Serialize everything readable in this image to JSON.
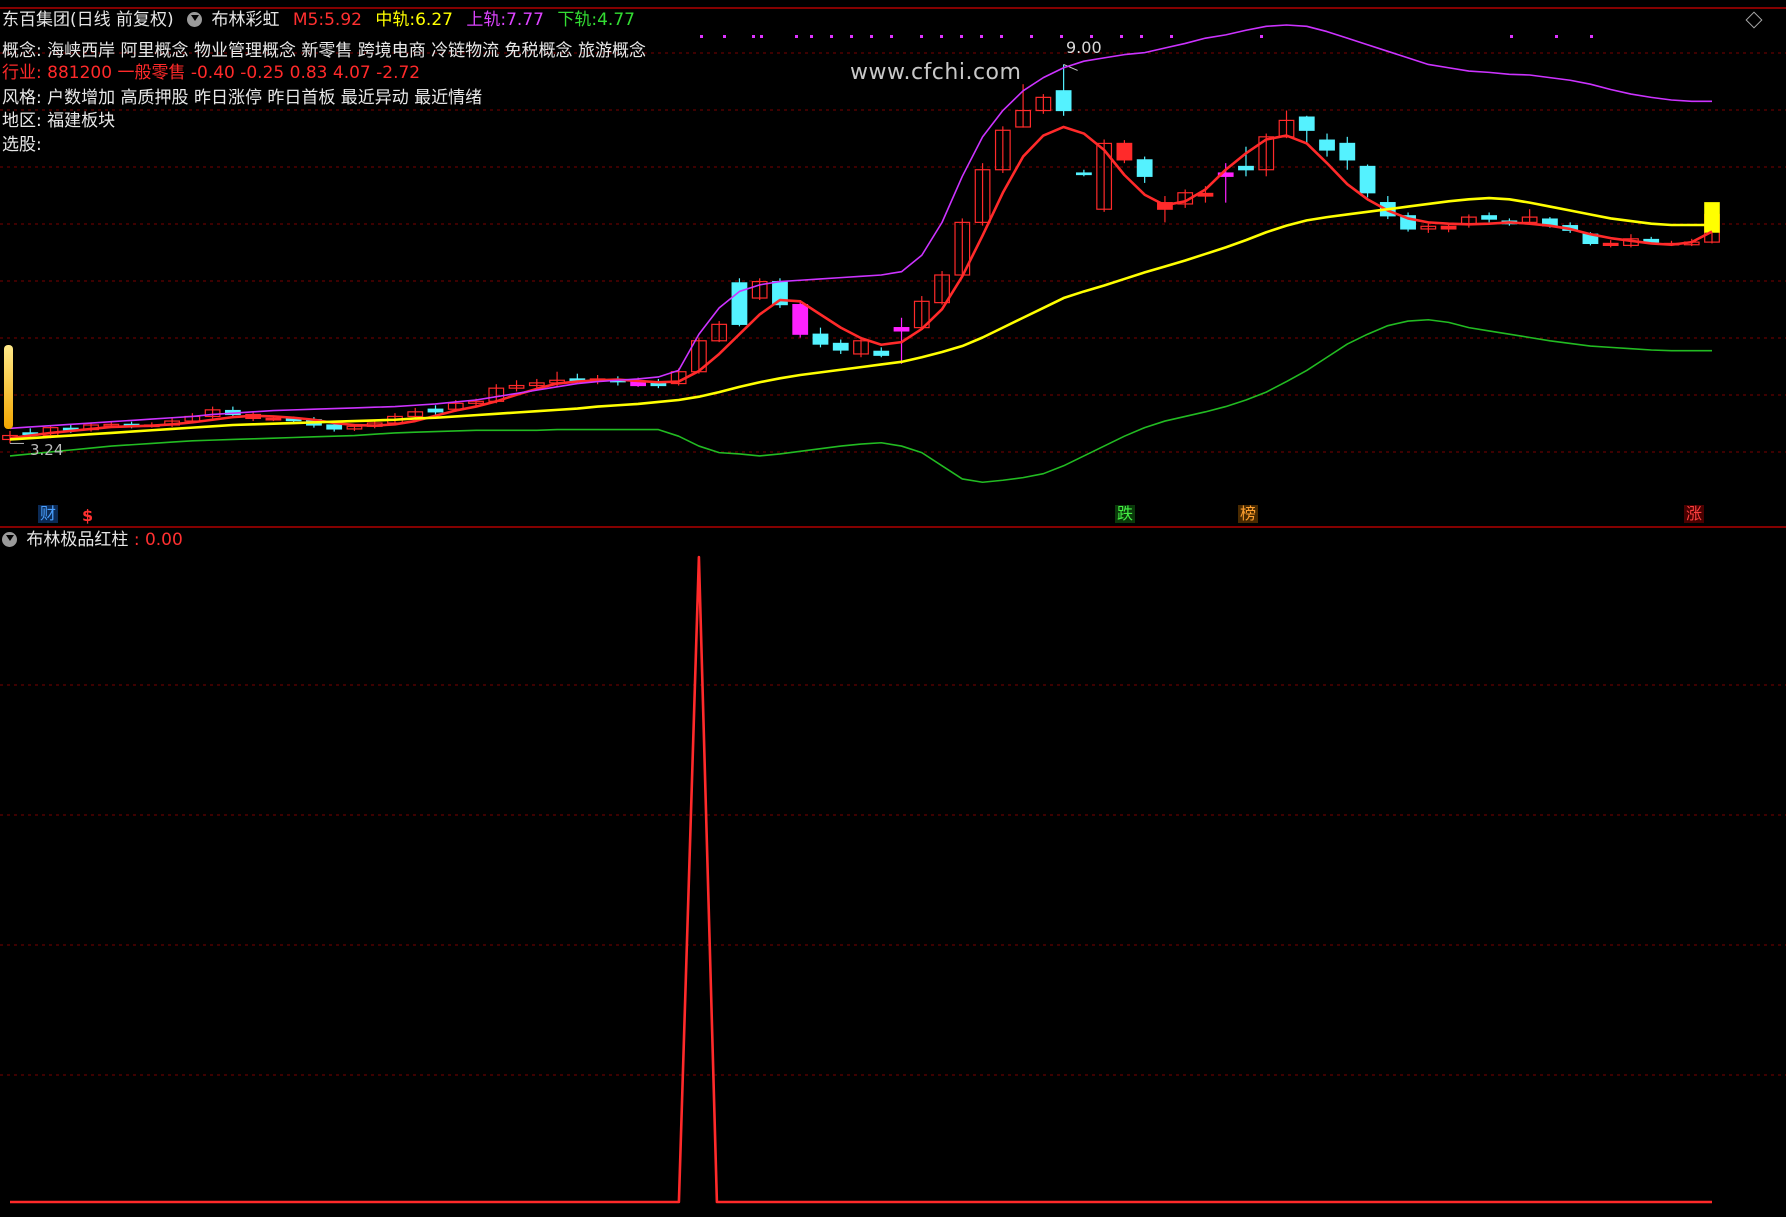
{
  "header": {
    "stock_title": "东百集团(日线 前复权)",
    "indicator_name": "布林彩虹",
    "m5_label": "M5:",
    "m5_value": "5.92",
    "mid_label": "中轨:",
    "mid_value": "6.27",
    "upper_label": "上轨:",
    "upper_value": "7.77",
    "lower_label": "下轨:",
    "lower_value": "4.77"
  },
  "info": {
    "concept_label": "概念:",
    "concept_value": "海峡西岸 阿里概念 物业管理概念 新零售 跨境电商 冷链物流 免税概念 旅游概念",
    "industry_label": "行业:",
    "industry_value": "881200 一般零售 -0.40 -0.25 0.83 4.07 -2.72",
    "style_label": "风格:",
    "style_value": "户数增加 高质押股 昨日涨停 昨日首板 最近异动 最近情绪",
    "region_label": "地区:",
    "region_value": "福建板块",
    "pick_label": "选股:"
  },
  "watermark": "www.cfchi.com",
  "price_labels": {
    "high": "9.00",
    "low": "3.24"
  },
  "badges": {
    "cai": "财",
    "dollar": "$",
    "die": "跌",
    "bang": "榜",
    "zhang": "涨"
  },
  "sub_panel": {
    "name": "布林极品红柱",
    "value_text": ": 0.00",
    "spike_index": 34
  },
  "colors": {
    "background": "#000000",
    "up": "#ff2a2a",
    "down": "#54f2ff",
    "highlight": "#ff22ff",
    "yellow": "#ffff00",
    "upper_band": "#cc33ff",
    "lower_band": "#22bb22",
    "grid": "#7a0000"
  },
  "chart_data": {
    "type": "candlestick",
    "x": [
      0,
      1,
      2,
      3,
      4,
      5,
      6,
      7,
      8,
      9,
      10,
      11,
      12,
      13,
      14,
      15,
      16,
      17,
      18,
      19,
      20,
      21,
      22,
      23,
      24,
      25,
      26,
      27,
      28,
      29,
      30,
      31,
      32,
      33,
      34,
      35,
      36,
      37,
      38,
      39,
      40,
      41,
      42,
      43,
      44,
      45,
      46,
      47,
      48,
      49,
      50,
      51,
      52,
      53,
      54,
      55,
      56,
      57,
      58,
      59,
      60,
      61,
      62,
      63,
      64,
      65,
      66,
      67,
      68,
      69,
      70,
      71,
      72,
      73,
      74,
      75,
      76,
      77,
      78,
      79,
      80,
      81,
      82,
      83,
      84
    ],
    "ylim": [
      2.0,
      9.6
    ],
    "candles": [
      [
        3.3,
        3.36,
        3.43,
        3.24,
        "up"
      ],
      [
        3.38,
        3.4,
        3.47,
        3.33,
        "down"
      ],
      [
        3.36,
        3.48,
        3.52,
        3.32,
        "up"
      ],
      [
        3.47,
        3.45,
        3.52,
        3.4,
        "down"
      ],
      [
        3.45,
        3.52,
        3.56,
        3.42,
        "up"
      ],
      [
        3.52,
        3.53,
        3.58,
        3.49,
        "up"
      ],
      [
        3.53,
        3.51,
        3.57,
        3.47,
        "down"
      ],
      [
        3.51,
        3.52,
        3.56,
        3.48,
        "up"
      ],
      [
        3.52,
        3.58,
        3.62,
        3.49,
        "up"
      ],
      [
        3.58,
        3.65,
        3.7,
        3.55,
        "up"
      ],
      [
        3.65,
        3.75,
        3.8,
        3.62,
        "up"
      ],
      [
        3.74,
        3.68,
        3.8,
        3.64,
        "down"
      ],
      [
        3.68,
        3.62,
        3.72,
        3.58,
        "up"
      ],
      [
        3.62,
        3.61,
        3.66,
        3.58,
        "up"
      ],
      [
        3.61,
        3.6,
        3.65,
        3.56,
        "down"
      ],
      [
        3.6,
        3.52,
        3.64,
        3.48,
        "down"
      ],
      [
        3.52,
        3.46,
        3.55,
        3.42,
        "down"
      ],
      [
        3.46,
        3.5,
        3.53,
        3.43,
        "up"
      ],
      [
        3.5,
        3.55,
        3.58,
        3.47,
        "up"
      ],
      [
        3.55,
        3.65,
        3.7,
        3.53,
        "up"
      ],
      [
        3.65,
        3.72,
        3.78,
        3.62,
        "up"
      ],
      [
        3.72,
        3.76,
        3.82,
        3.68,
        "down"
      ],
      [
        3.76,
        3.85,
        3.9,
        3.72,
        "up"
      ],
      [
        3.85,
        3.88,
        3.92,
        3.8,
        "up"
      ],
      [
        3.88,
        4.08,
        4.14,
        3.85,
        "up"
      ],
      [
        4.08,
        4.12,
        4.2,
        4.03,
        "up"
      ],
      [
        4.12,
        4.16,
        4.22,
        4.08,
        "up"
      ],
      [
        4.16,
        4.2,
        4.33,
        4.1,
        "up"
      ],
      [
        4.2,
        4.22,
        4.3,
        4.15,
        "down"
      ],
      [
        4.22,
        4.2,
        4.28,
        4.14,
        "up"
      ],
      [
        4.2,
        4.18,
        4.26,
        4.12,
        "down"
      ],
      [
        4.18,
        4.12,
        4.24,
        4.1,
        "highlight"
      ],
      [
        4.12,
        4.15,
        4.22,
        4.08,
        "down"
      ],
      [
        4.15,
        4.33,
        4.38,
        4.12,
        "up"
      ],
      [
        4.33,
        4.8,
        4.85,
        4.3,
        "up"
      ],
      [
        4.8,
        5.05,
        5.1,
        4.78,
        "up"
      ],
      [
        5.05,
        5.68,
        5.75,
        5.02,
        "down"
      ],
      [
        5.45,
        5.7,
        5.75,
        5.42,
        "up"
      ],
      [
        5.7,
        5.35,
        5.75,
        5.3,
        "down"
      ],
      [
        5.35,
        4.9,
        5.42,
        4.85,
        "highlight"
      ],
      [
        4.9,
        4.75,
        5.0,
        4.7,
        "down"
      ],
      [
        4.76,
        4.66,
        4.82,
        4.6,
        "down"
      ],
      [
        4.6,
        4.8,
        4.86,
        4.55,
        "up"
      ],
      [
        4.64,
        4.58,
        4.7,
        4.55,
        "down"
      ],
      [
        4.95,
        5.0,
        5.15,
        4.45,
        "highlight"
      ],
      [
        5.0,
        5.4,
        5.48,
        4.98,
        "up"
      ],
      [
        5.38,
        5.8,
        5.86,
        5.35,
        "up"
      ],
      [
        5.8,
        6.6,
        6.66,
        5.78,
        "up"
      ],
      [
        6.6,
        7.4,
        7.5,
        6.55,
        "up"
      ],
      [
        7.4,
        8.0,
        8.06,
        7.35,
        "up"
      ],
      [
        8.05,
        8.3,
        8.7,
        8.04,
        "up"
      ],
      [
        8.3,
        8.5,
        8.55,
        8.25,
        "up"
      ],
      [
        8.6,
        8.3,
        9.0,
        8.22,
        "down"
      ],
      [
        7.35,
        7.34,
        7.4,
        7.3,
        "down"
      ],
      [
        6.8,
        7.8,
        7.86,
        6.76,
        "up"
      ],
      [
        7.8,
        7.55,
        7.85,
        7.5,
        "up"
      ],
      [
        7.55,
        7.3,
        7.6,
        7.2,
        "down"
      ],
      [
        6.9,
        6.8,
        7.0,
        6.6,
        "up"
      ],
      [
        6.88,
        7.05,
        7.1,
        6.82,
        "up"
      ],
      [
        7.04,
        7.0,
        7.15,
        6.9,
        "up"
      ],
      [
        7.35,
        7.3,
        7.5,
        6.9,
        "highlight"
      ],
      [
        7.4,
        7.45,
        7.75,
        7.3,
        "down"
      ],
      [
        7.4,
        7.9,
        7.95,
        7.3,
        "up"
      ],
      [
        7.9,
        8.15,
        8.3,
        7.88,
        "up"
      ],
      [
        8.2,
        8.0,
        8.22,
        7.8,
        "down"
      ],
      [
        7.85,
        7.7,
        7.95,
        7.6,
        "down"
      ],
      [
        7.8,
        7.55,
        7.9,
        7.4,
        "down"
      ],
      [
        7.45,
        7.05,
        7.48,
        6.98,
        "down"
      ],
      [
        6.9,
        6.7,
        7.0,
        6.65,
        "down"
      ],
      [
        6.7,
        6.5,
        6.75,
        6.46,
        "down"
      ],
      [
        6.5,
        6.54,
        6.58,
        6.44,
        "up"
      ],
      [
        6.54,
        6.5,
        6.57,
        6.45,
        "up"
      ],
      [
        6.58,
        6.68,
        6.72,
        6.52,
        "up"
      ],
      [
        6.7,
        6.65,
        6.75,
        6.6,
        "down"
      ],
      [
        6.62,
        6.58,
        6.66,
        6.55,
        "down"
      ],
      [
        6.6,
        6.68,
        6.8,
        6.58,
        "up"
      ],
      [
        6.65,
        6.55,
        6.68,
        6.52,
        "down"
      ],
      [
        6.55,
        6.48,
        6.6,
        6.44,
        "down"
      ],
      [
        6.42,
        6.28,
        6.45,
        6.25,
        "down"
      ],
      [
        6.28,
        6.25,
        6.33,
        6.22,
        "up"
      ],
      [
        6.25,
        6.35,
        6.42,
        6.22,
        "up"
      ],
      [
        6.34,
        6.3,
        6.38,
        6.27,
        "down"
      ],
      [
        6.28,
        6.26,
        6.32,
        6.24,
        "up"
      ],
      [
        6.26,
        6.3,
        6.35,
        6.24,
        "up"
      ],
      [
        6.3,
        6.72,
        6.75,
        6.28,
        "up"
      ]
    ],
    "special_last_candle": [
      6.45,
      6.9,
      "yellow"
    ],
    "series": [
      {
        "name": "M5",
        "values": [
          3.32,
          3.36,
          3.4,
          3.43,
          3.46,
          3.49,
          3.5,
          3.51,
          3.53,
          3.56,
          3.6,
          3.64,
          3.66,
          3.65,
          3.63,
          3.6,
          3.55,
          3.52,
          3.51,
          3.53,
          3.58,
          3.66,
          3.74,
          3.8,
          3.88,
          3.98,
          4.07,
          4.15,
          4.18,
          4.2,
          4.21,
          4.19,
          4.17,
          4.18,
          4.34,
          4.6,
          4.9,
          5.2,
          5.42,
          5.4,
          5.2,
          5.0,
          4.84,
          4.74,
          4.78,
          4.98,
          5.28,
          5.78,
          6.4,
          7.05,
          7.6,
          7.92,
          8.05,
          7.95,
          7.7,
          7.32,
          7.02,
          6.86,
          6.92,
          7.1,
          7.4,
          7.65,
          7.86,
          7.92,
          7.8,
          7.5,
          7.18,
          6.95,
          6.78,
          6.66,
          6.6,
          6.58,
          6.57,
          6.58,
          6.6,
          6.58,
          6.55,
          6.5,
          6.42,
          6.36,
          6.32,
          6.28,
          6.26,
          6.3,
          6.46
        ]
      },
      {
        "name": "中轨",
        "values": [
          3.3,
          3.32,
          3.34,
          3.36,
          3.38,
          3.4,
          3.42,
          3.44,
          3.46,
          3.48,
          3.5,
          3.52,
          3.53,
          3.54,
          3.55,
          3.56,
          3.57,
          3.58,
          3.59,
          3.6,
          3.62,
          3.63,
          3.65,
          3.67,
          3.69,
          3.71,
          3.73,
          3.75,
          3.77,
          3.8,
          3.82,
          3.84,
          3.87,
          3.9,
          3.95,
          4.02,
          4.1,
          4.17,
          4.23,
          4.28,
          4.32,
          4.36,
          4.4,
          4.44,
          4.48,
          4.55,
          4.63,
          4.72,
          4.85,
          5.0,
          5.15,
          5.3,
          5.45,
          5.55,
          5.64,
          5.74,
          5.84,
          5.93,
          6.02,
          6.12,
          6.22,
          6.33,
          6.45,
          6.55,
          6.63,
          6.68,
          6.72,
          6.76,
          6.8,
          6.84,
          6.88,
          6.92,
          6.95,
          6.97,
          6.95,
          6.9,
          6.84,
          6.78,
          6.72,
          6.66,
          6.62,
          6.58,
          6.56,
          6.56,
          6.56
        ]
      },
      {
        "name": "上轨",
        "values": [
          3.47,
          3.49,
          3.51,
          3.53,
          3.55,
          3.57,
          3.59,
          3.61,
          3.63,
          3.65,
          3.68,
          3.7,
          3.72,
          3.74,
          3.75,
          3.76,
          3.77,
          3.78,
          3.79,
          3.8,
          3.82,
          3.84,
          3.87,
          3.9,
          3.95,
          4.0,
          4.05,
          4.1,
          4.15,
          4.18,
          4.2,
          4.22,
          4.25,
          4.35,
          4.9,
          5.3,
          5.55,
          5.65,
          5.7,
          5.72,
          5.74,
          5.76,
          5.78,
          5.8,
          5.85,
          6.1,
          6.6,
          7.3,
          7.9,
          8.3,
          8.6,
          8.8,
          8.95,
          9.05,
          9.1,
          9.15,
          9.18,
          9.25,
          9.32,
          9.4,
          9.45,
          9.52,
          9.58,
          9.6,
          9.58,
          9.5,
          9.4,
          9.3,
          9.2,
          9.1,
          9.0,
          8.95,
          8.9,
          8.88,
          8.85,
          8.84,
          8.8,
          8.76,
          8.7,
          8.62,
          8.55,
          8.5,
          8.46,
          8.44,
          8.44
        ]
      },
      {
        "name": "下轨",
        "values": [
          3.05,
          3.08,
          3.11,
          3.14,
          3.17,
          3.2,
          3.22,
          3.24,
          3.26,
          3.28,
          3.29,
          3.3,
          3.31,
          3.32,
          3.33,
          3.34,
          3.35,
          3.36,
          3.38,
          3.4,
          3.41,
          3.42,
          3.43,
          3.44,
          3.44,
          3.44,
          3.44,
          3.45,
          3.45,
          3.45,
          3.45,
          3.45,
          3.45,
          3.35,
          3.2,
          3.1,
          3.08,
          3.05,
          3.08,
          3.12,
          3.16,
          3.2,
          3.23,
          3.25,
          3.2,
          3.1,
          2.9,
          2.7,
          2.65,
          2.68,
          2.72,
          2.78,
          2.9,
          3.05,
          3.2,
          3.35,
          3.48,
          3.58,
          3.65,
          3.72,
          3.8,
          3.9,
          4.02,
          4.18,
          4.35,
          4.55,
          4.75,
          4.9,
          5.03,
          5.1,
          5.12,
          5.08,
          5.0,
          4.95,
          4.9,
          4.85,
          4.8,
          4.76,
          4.72,
          4.7,
          4.68,
          4.66,
          4.65,
          4.65,
          4.65
        ]
      }
    ]
  }
}
